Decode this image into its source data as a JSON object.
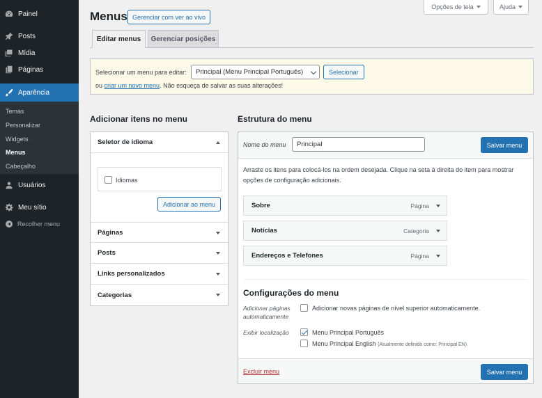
{
  "sidebar": {
    "items": [
      {
        "label": "Painel",
        "icon": "dashboard-icon"
      },
      {
        "label": "Posts",
        "icon": "pin-icon"
      },
      {
        "label": "Mídia",
        "icon": "media-icon"
      },
      {
        "label": "Páginas",
        "icon": "pages-icon"
      },
      {
        "label": "Aparência",
        "icon": "paintbrush-icon"
      },
      {
        "label": "Usuários",
        "icon": "users-icon"
      },
      {
        "label": "Meu sítio",
        "icon": "gear-icon"
      }
    ],
    "submenu": [
      "Temas",
      "Personalizar",
      "Widgets",
      "Menus",
      "Cabeçalho"
    ],
    "collapse": "Recolher menu"
  },
  "top": {
    "screen_options": "Opções de tela",
    "help": "Ajuda"
  },
  "header": {
    "title": "Menus",
    "manage_live": "Gerenciar com ver ao vivo"
  },
  "tabs": [
    {
      "label": "Editar menus"
    },
    {
      "label": "Gerenciar posições"
    }
  ],
  "select_menu": {
    "label": "Selecionar um menu para editar:",
    "selected": "Principal (Menu Principal Português)",
    "button": "Selecionar",
    "prefix": "ou",
    "link": "criar um novo menu",
    "suffix": ". Não esqueça de salvar as suas alterações!"
  },
  "add_items": {
    "title": "Adicionar itens no menu",
    "language_selector": "Seletor de idioma",
    "languages_option": "Idiomas",
    "add_button": "Adicionar ao menu",
    "sections": [
      "Páginas",
      "Posts",
      "Links personalizados",
      "Categorias"
    ]
  },
  "structure": {
    "title": "Estrutura do menu",
    "name_label": "Nome do menu",
    "name_value": "Principal",
    "save": "Salvar menu",
    "instructions": "Arraste os itens para colocá-los na ordem desejada. Clique na seta à direita do item para mostrar opções de configuração adicionais.",
    "items": [
      {
        "label": "Sobre",
        "type": "Página"
      },
      {
        "label": "Notícias",
        "type": "Categoria"
      },
      {
        "label": "Endereços e Telefones",
        "type": "Página"
      }
    ],
    "settings_title": "Configurações do menu",
    "auto_add_label": "Adicionar páginas automaticamente",
    "auto_add_text": "Adicionar novas páginas de nível superior automaticamente.",
    "location_label": "Exibir localização",
    "locations": [
      {
        "label": "Menu Principal Português",
        "checked": true,
        "note": ""
      },
      {
        "label": "Menu Principal English",
        "checked": false,
        "note": "(Atualmente definido como: Principal EN)"
      }
    ],
    "delete": "Excluir menu"
  },
  "colors": {
    "accent": "#2271b1",
    "sidebar": "#1d2327",
    "danger": "#b32d2e"
  }
}
